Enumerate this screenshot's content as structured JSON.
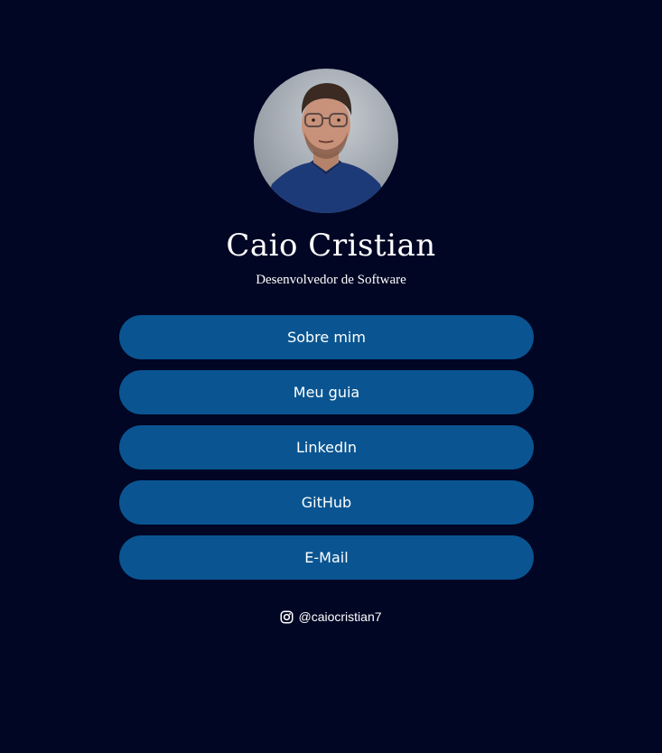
{
  "profile": {
    "name": "Caio Cristian",
    "role": "Desenvolvedor de Software"
  },
  "links": [
    {
      "label": "Sobre mim"
    },
    {
      "label": "Meu guia"
    },
    {
      "label": "LinkedIn"
    },
    {
      "label": "GitHub"
    },
    {
      "label": "E-Mail"
    }
  ],
  "social": {
    "icon": "instagram-icon",
    "handle": "@caiocristian7"
  },
  "colors": {
    "background": "#000624",
    "button": "#0a5591",
    "text": "#ffffff"
  }
}
